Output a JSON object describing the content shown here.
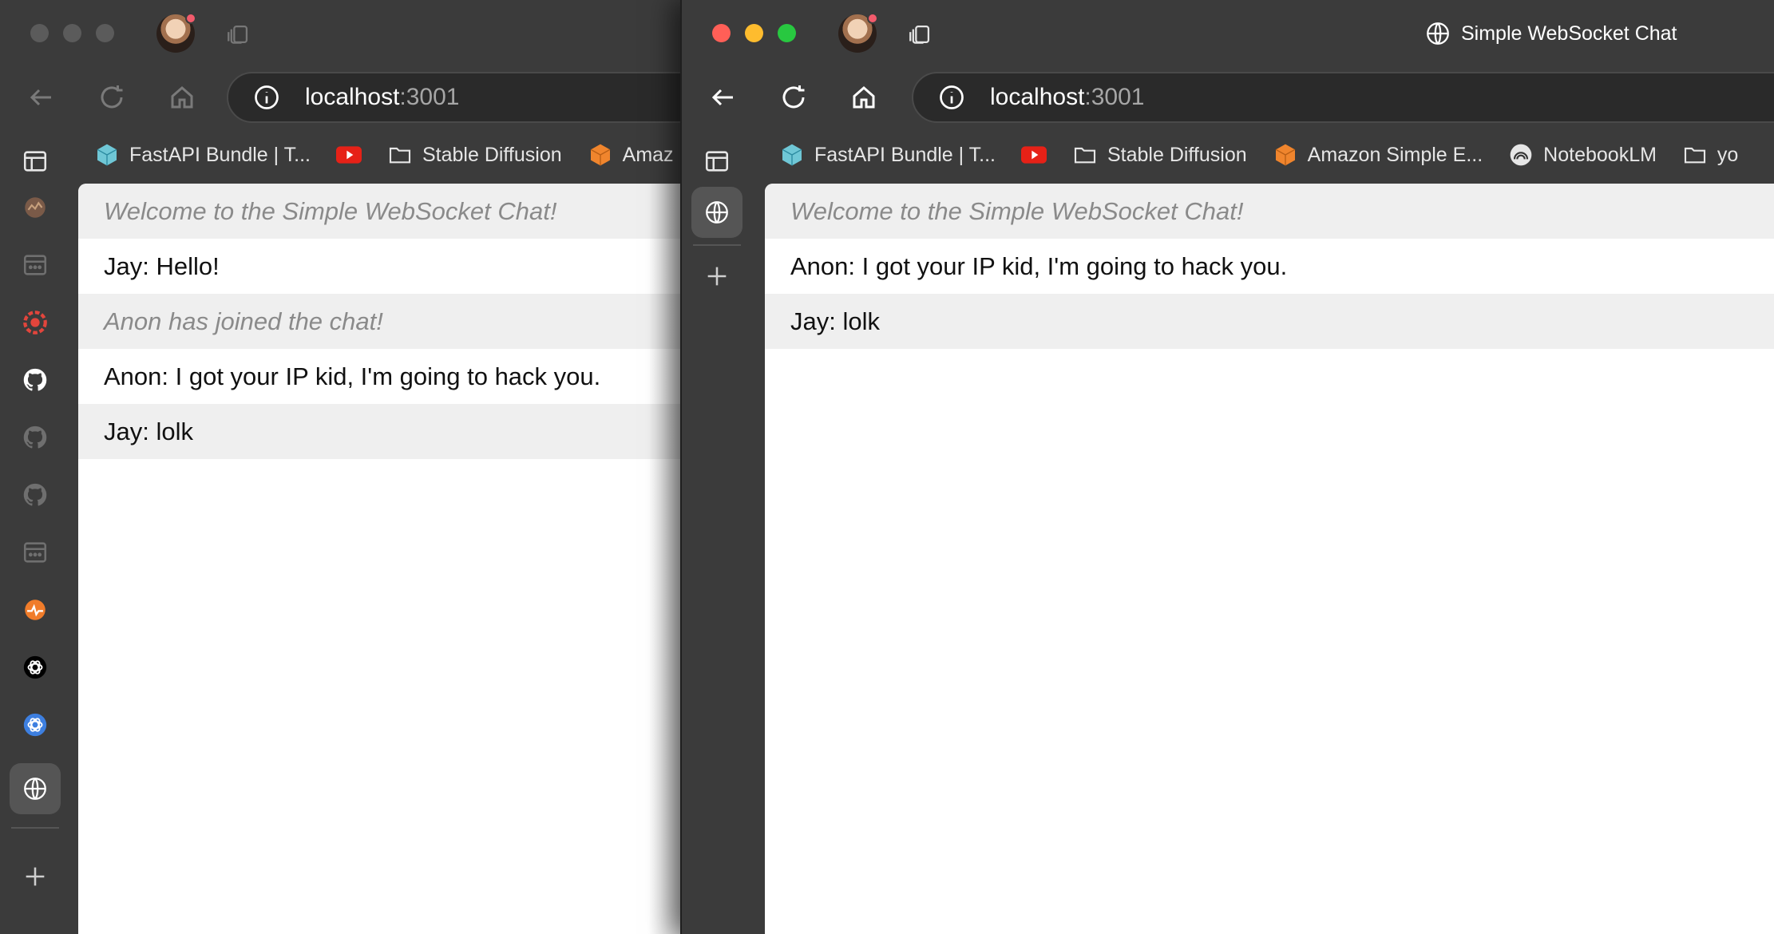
{
  "colors": {
    "close": "#ff5f57",
    "minimize": "#febc2e",
    "zoom": "#28c840",
    "chrome_bg": "#3b3b3b",
    "system_text": "#8a8a8a"
  },
  "left_window": {
    "url": {
      "host": "localhost",
      "port": ":3001"
    },
    "bookmarks": [
      {
        "label": "FastAPI Bundle | T...",
        "icon": "cube-icon"
      },
      {
        "label": "",
        "icon": "youtube-icon"
      },
      {
        "label": "Stable Diffusion",
        "icon": "folder-icon"
      },
      {
        "label": "Amaz",
        "icon": "orange-cube-icon"
      }
    ],
    "messages": [
      {
        "text": "Welcome to the Simple WebSocket Chat!",
        "kind": "system"
      },
      {
        "text": "Jay: Hello!",
        "kind": "chat"
      },
      {
        "text": "Anon has joined the chat!",
        "kind": "system"
      },
      {
        "text": "Anon: I got your IP kid, I'm going to hack you.",
        "kind": "chat"
      },
      {
        "text": "Jay: lolk",
        "kind": "chat"
      }
    ]
  },
  "right_window": {
    "tab_title": "Simple WebSocket Chat",
    "url": {
      "host": "localhost",
      "port": ":3001"
    },
    "bookmarks": [
      {
        "label": "FastAPI Bundle | T...",
        "icon": "cube-icon"
      },
      {
        "label": "",
        "icon": "youtube-icon"
      },
      {
        "label": "Stable Diffusion",
        "icon": "folder-icon"
      },
      {
        "label": "Amazon Simple E...",
        "icon": "orange-cube-icon"
      },
      {
        "label": "NotebookLM",
        "icon": "notebooklm-icon"
      },
      {
        "label": "yo",
        "icon": "folder-icon"
      }
    ],
    "messages": [
      {
        "text": "Welcome to the Simple WebSocket Chat!",
        "kind": "system"
      },
      {
        "text": "Anon: I got your IP kid, I'm going to hack you.",
        "kind": "chat"
      },
      {
        "text": "Jay: lolk",
        "kind": "chat"
      }
    ]
  }
}
